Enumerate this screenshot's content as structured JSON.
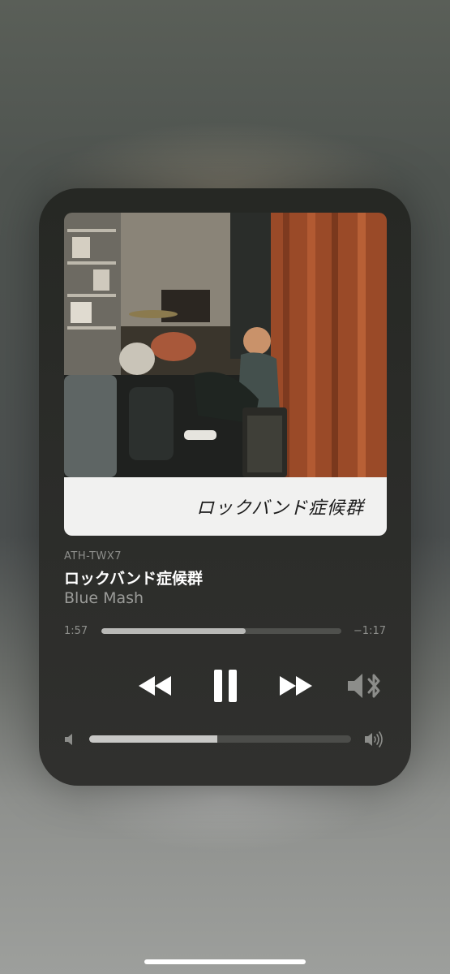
{
  "player": {
    "artwork": {
      "title_text": "ロックバンド症候群"
    },
    "device_name": "ATH-TWX7",
    "track_title": "ロックバンド症候群",
    "artist": "Blue Mash",
    "progress": {
      "elapsed": "1:57",
      "remaining": "−1:17",
      "fraction": 0.6
    },
    "controls": {
      "rewind_icon": "rewind-icon",
      "pause_icon": "pause-icon",
      "forward_icon": "fast-forward-icon",
      "output_icon": "bluetooth-speaker-icon"
    },
    "volume": {
      "level": 0.49,
      "min_icon": "speaker-low-icon",
      "max_icon": "speaker-high-icon"
    }
  },
  "colors": {
    "card_background": "#2b2c29",
    "text_primary": "#ffffff",
    "text_secondary": "#9a9b98",
    "track_fill": "#b9b9b7"
  }
}
